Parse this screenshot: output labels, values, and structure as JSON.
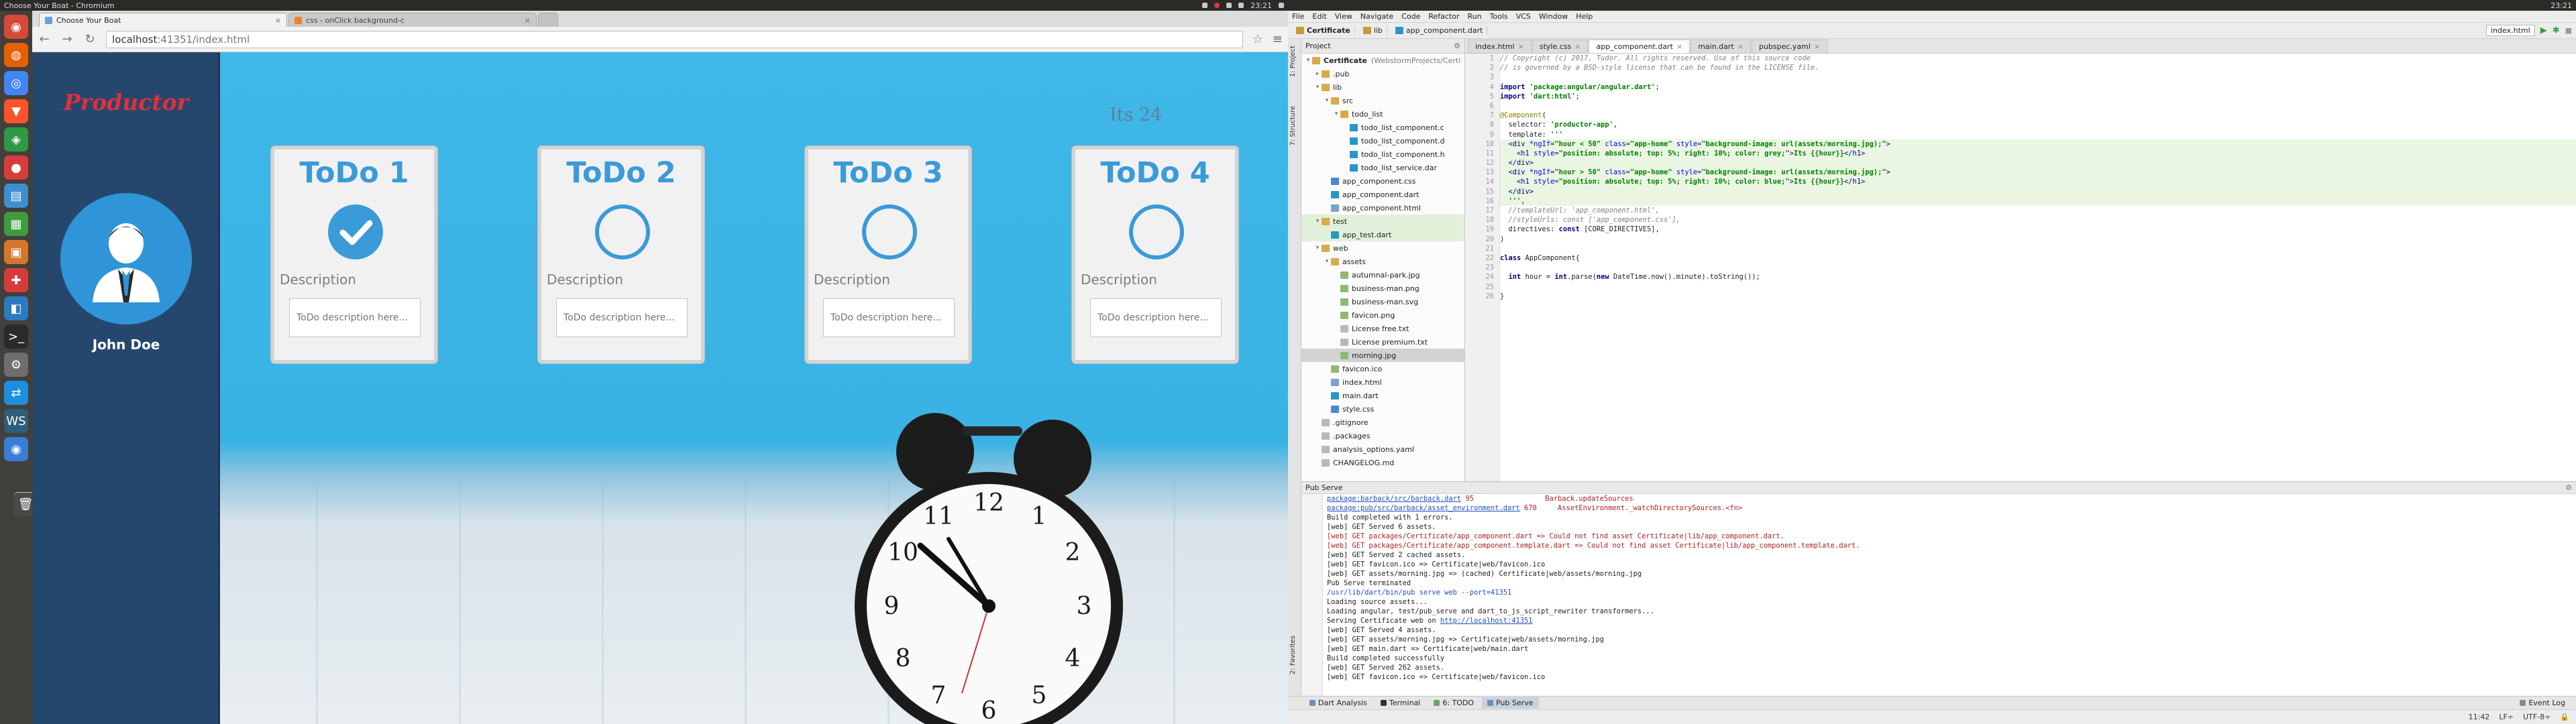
{
  "left_screen": {
    "os_title": "Choose Your Boat - Chromium",
    "tabs": [
      {
        "label": "Choose Your Boat",
        "active": true
      },
      {
        "label": "css - onClick background-c",
        "active": false
      }
    ],
    "url_host": "localhost",
    "url_path": ":41351/index.html",
    "app": {
      "brand": "Productor",
      "user_name": "John Doe",
      "hour_text": "Its 24",
      "cards": [
        {
          "title": "ToDo 1",
          "done": true,
          "desc_label": "Description",
          "desc_placeholder": "ToDo description here..."
        },
        {
          "title": "ToDo 2",
          "done": false,
          "desc_label": "Description",
          "desc_placeholder": "ToDo description here..."
        },
        {
          "title": "ToDo 3",
          "done": false,
          "desc_label": "Description",
          "desc_placeholder": "ToDo description here..."
        },
        {
          "title": "ToDo 4",
          "done": false,
          "desc_label": "Description",
          "desc_placeholder": "ToDo description here..."
        }
      ]
    },
    "time": "23:21"
  },
  "ide": {
    "menu": [
      "File",
      "Edit",
      "View",
      "Navigate",
      "Code",
      "Refactor",
      "Run",
      "Tools",
      "VCS",
      "Window",
      "Help"
    ],
    "breadcrumbs": [
      "Certificate",
      "lib",
      "app_component.dart"
    ],
    "run_config": "index.html",
    "project_header": "Project",
    "editor_tabs": [
      {
        "label": "index.html",
        "active": false
      },
      {
        "label": "style.css",
        "active": false
      },
      {
        "label": "app_component.dart",
        "active": true
      },
      {
        "label": "main.dart",
        "active": false
      },
      {
        "label": "pubspec.yaml",
        "active": false
      }
    ],
    "tree": [
      {
        "depth": 0,
        "tw": "▾",
        "type": "folder",
        "label": "Certificate",
        "muted": "(WebstormProjects/Certi",
        "bold": true
      },
      {
        "depth": 1,
        "tw": "▸",
        "type": "folder",
        "label": ".pub"
      },
      {
        "depth": 1,
        "tw": "▾",
        "type": "folder",
        "label": "lib"
      },
      {
        "depth": 2,
        "tw": "▾",
        "type": "folder",
        "label": "src"
      },
      {
        "depth": 3,
        "tw": "▾",
        "type": "folder",
        "label": "todo_list"
      },
      {
        "depth": 4,
        "tw": "",
        "type": "dart",
        "label": "todo_list_component.c"
      },
      {
        "depth": 4,
        "tw": "",
        "type": "dart",
        "label": "todo_list_component.d"
      },
      {
        "depth": 4,
        "tw": "",
        "type": "dart",
        "label": "todo_list_component.h"
      },
      {
        "depth": 4,
        "tw": "",
        "type": "dart",
        "label": "todo_list_service.dar"
      },
      {
        "depth": 2,
        "tw": "",
        "type": "css",
        "label": "app_component.css"
      },
      {
        "depth": 2,
        "tw": "",
        "type": "dart",
        "label": "app_component.dart"
      },
      {
        "depth": 2,
        "tw": "",
        "type": "file",
        "label": "app_component.html"
      },
      {
        "depth": 1,
        "tw": "▾",
        "type": "folder",
        "label": "test",
        "hl": true
      },
      {
        "depth": 2,
        "tw": "",
        "type": "dart",
        "label": "app_test.dart",
        "hl": true
      },
      {
        "depth": 1,
        "tw": "▾",
        "type": "folder",
        "label": "web"
      },
      {
        "depth": 2,
        "tw": "▾",
        "type": "folder",
        "label": "assets"
      },
      {
        "depth": 3,
        "tw": "",
        "type": "img",
        "label": "autumnal-park.jpg"
      },
      {
        "depth": 3,
        "tw": "",
        "type": "img",
        "label": "business-man.png"
      },
      {
        "depth": 3,
        "tw": "",
        "type": "img",
        "label": "business-man.svg"
      },
      {
        "depth": 3,
        "tw": "",
        "type": "img",
        "label": "favicon.png"
      },
      {
        "depth": 3,
        "tw": "",
        "type": "txt",
        "label": "License free.txt"
      },
      {
        "depth": 3,
        "tw": "",
        "type": "txt",
        "label": "License premium.txt"
      },
      {
        "depth": 3,
        "tw": "",
        "type": "img",
        "label": "morning.jpg",
        "sel": true
      },
      {
        "depth": 2,
        "tw": "",
        "type": "img",
        "label": "favicon.ico"
      },
      {
        "depth": 2,
        "tw": "",
        "type": "file",
        "label": "index.html"
      },
      {
        "depth": 2,
        "tw": "",
        "type": "dart",
        "label": "main.dart"
      },
      {
        "depth": 2,
        "tw": "",
        "type": "css",
        "label": "style.css"
      },
      {
        "depth": 1,
        "tw": "",
        "type": "txt",
        "label": ".gitignore"
      },
      {
        "depth": 1,
        "tw": "",
        "type": "txt",
        "label": ".packages"
      },
      {
        "depth": 1,
        "tw": "",
        "type": "txt",
        "label": "analysis_options.yaml"
      },
      {
        "depth": 1,
        "tw": "",
        "type": "txt",
        "label": "CHANGELOG.md"
      }
    ],
    "code_lines": [
      {
        "cls": "",
        "html": "<span class=\"tk-cm\">// Copyright (c) 2017, Tudor. All rights reserved. Use of this source code</span>"
      },
      {
        "cls": "",
        "html": "<span class=\"tk-cm\">// is governed by a BSD-style license that can be found in the LICENSE file.</span>"
      },
      {
        "cls": "",
        "html": ""
      },
      {
        "cls": "",
        "html": "<span class=\"tk-kw\">import</span> <span class=\"tk-st\">'package:angular/angular.dart'</span>;"
      },
      {
        "cls": "",
        "html": "<span class=\"tk-kw\">import</span> <span class=\"tk-st\">'dart:html'</span>;"
      },
      {
        "cls": "",
        "html": ""
      },
      {
        "cls": "",
        "html": "<span class=\"tk-an\">@Component</span>("
      },
      {
        "cls": "",
        "html": "  selector: <span class=\"tk-st\">'productor-app'</span>,"
      },
      {
        "cls": "",
        "html": "  template: <span class=\"tk-st\">'''</span>"
      },
      {
        "cls": "green",
        "html": "  <span class=\"tk-tg\">&lt;div</span> <span class=\"tk-at\">*ngIf</span>=<span class=\"tk-st\">\"hour &lt; 50\"</span> <span class=\"tk-at\">class</span>=<span class=\"tk-st\">\"app-home\"</span> <span class=\"tk-at\">style</span>=<span class=\"tk-st\">\"background-image: url(assets/morning.jpg);\"</span><span class=\"tk-tg\">&gt;</span>"
      },
      {
        "cls": "green",
        "html": "    <span class=\"tk-tg\">&lt;h1</span> <span class=\"tk-at\">style</span>=<span class=\"tk-st\">\"position: absolute; top: 5%; right: 10%; color: grey;\"</span><span class=\"tk-tg\">&gt;</span><span class=\"tk-st\">Its {{hour}}</span><span class=\"tk-tg\">&lt;/h1&gt;</span>"
      },
      {
        "cls": "green",
        "html": "  <span class=\"tk-tg\">&lt;/div&gt;</span>"
      },
      {
        "cls": "green",
        "html": "  <span class=\"tk-tg\">&lt;div</span> <span class=\"tk-at\">*ngIf</span>=<span class=\"tk-st\">\"hour &gt; 50\"</span> <span class=\"tk-at\">class</span>=<span class=\"tk-st\">\"app-home\"</span> <span class=\"tk-at\">style</span>=<span class=\"tk-st\">\"background-image: url(assets/morning.jpg);\"</span><span class=\"tk-tg\">&gt;</span>"
      },
      {
        "cls": "green",
        "html": "    <span class=\"tk-tg\">&lt;h1</span> <span class=\"tk-at\">style</span>=<span class=\"tk-st\">\"position: absolute; top: 5%; right: 10%; color: blue;\"</span><span class=\"tk-tg\">&gt;</span><span class=\"tk-st\">Its {{hour}}</span><span class=\"tk-tg\">&lt;/h1&gt;</span>"
      },
      {
        "cls": "green",
        "html": "  <span class=\"tk-tg\">&lt;/div&gt;</span>"
      },
      {
        "cls": "green",
        "html": "  <span class=\"tk-st\">'''</span>,"
      },
      {
        "cls": "",
        "html": "  <span class=\"tk-cm\">//templateUrl: 'app_component.html',</span>"
      },
      {
        "cls": "",
        "html": "  <span class=\"tk-cm\">//styleUrls: const ['app_component.css'],</span>"
      },
      {
        "cls": "",
        "html": "  directives: <span class=\"tk-kw\">const</span> [CORE_DIRECTIVES],"
      },
      {
        "cls": "",
        "html": ")"
      },
      {
        "cls": "",
        "html": ""
      },
      {
        "cls": "",
        "html": "<span class=\"tk-kw\">class</span> AppComponent{"
      },
      {
        "cls": "",
        "html": ""
      },
      {
        "cls": "",
        "html": "  <span class=\"tk-kw\">int</span> hour = <span class=\"tk-kw\">int</span>.parse(<span class=\"tk-kw\">new</span> DateTime.now().minute).toString());"
      },
      {
        "cls": "",
        "html": ""
      },
      {
        "cls": "",
        "html": "}"
      }
    ],
    "pub_serve_title": "Pub Serve",
    "console_lines": [
      {
        "cls": "err-link",
        "text": "package:barback/src/barback.dart 95                 Barback.updateSources"
      },
      {
        "cls": "err-link",
        "text": "package:pub/src/barback/asset_environment.dart 670     AssetEnvironment._watchDirectorySources.<fn>"
      },
      {
        "cls": "",
        "text": "Build completed with 1 errors."
      },
      {
        "cls": "",
        "text": "[web] GET Served 6 assets."
      },
      {
        "cls": "err",
        "text": "[web] GET packages/Certificate/app_component.dart => Could not find asset Certificate|lib/app_component.dart."
      },
      {
        "cls": "err",
        "text": "[web] GET packages/Certificate/app_component.template.dart => Could not find asset Certificate|lib/app_component.template.dart."
      },
      {
        "cls": "",
        "text": "[web] GET Served 2 cached assets."
      },
      {
        "cls": "",
        "text": "[web] GET favicon.ico => Certificate|web/favicon.ico"
      },
      {
        "cls": "",
        "text": "[web] GET assets/morning.jpg => (cached) Certificate|web/assets/morning.jpg"
      },
      {
        "cls": "",
        "text": "Pub Serve terminated"
      },
      {
        "cls": "link",
        "text": "/usr/lib/dart/bin/pub serve web --port=41351"
      },
      {
        "cls": "",
        "text": "Loading source assets..."
      },
      {
        "cls": "",
        "text": "Loading angular, test/pub_serve and dart_to_js_script_rewriter transformers..."
      },
      {
        "cls": "serving",
        "text": "Serving Certificate web on ",
        "link": "http://localhost:41351"
      },
      {
        "cls": "",
        "text": "[web] GET Served 4 assets."
      },
      {
        "cls": "",
        "text": "[web] GET assets/morning.jpg => Certificate|web/assets/morning.jpg"
      },
      {
        "cls": "",
        "text": "[web] GET main.dart => Certificate|web/main.dart"
      },
      {
        "cls": "",
        "text": "Build completed successfully"
      },
      {
        "cls": "",
        "text": "[web] GET Served 262 assets."
      },
      {
        "cls": "",
        "text": "[web] GET favicon.ico => Certificate|web/favicon.ico"
      }
    ],
    "bottom_tabs": [
      {
        "label": "Dart Analysis",
        "active": false
      },
      {
        "label": "Terminal",
        "active": false
      },
      {
        "label": "6: TODO",
        "active": false
      },
      {
        "label": "Pub Serve",
        "active": true
      }
    ],
    "event_log": "Event Log",
    "status": {
      "position": "11:42",
      "line_sep": "LF÷",
      "encoding": "UTF-8÷"
    },
    "vertical_tabs": [
      "1: Project",
      "7: Structure",
      "2: Favorites"
    ],
    "time": "23:21"
  },
  "colors": {
    "accent": "#3b9ad8",
    "brand": "#e0303a",
    "sidebar": "#26476d"
  }
}
